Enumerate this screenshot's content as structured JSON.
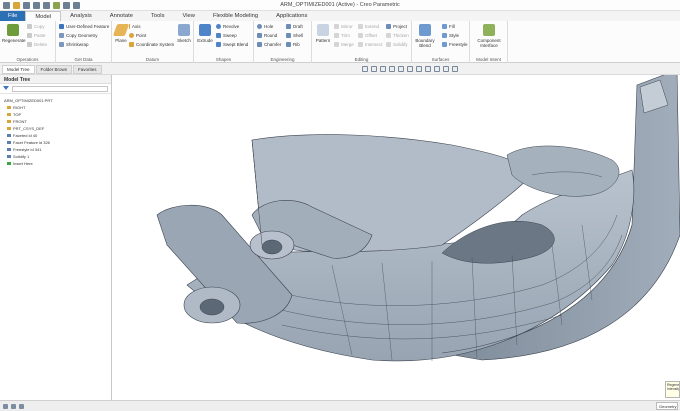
{
  "window": {
    "title": "ARM_OPTIMIZED001 (Active) - Creo Parametric"
  },
  "tabs": [
    {
      "label": "File"
    },
    {
      "label": "Model"
    },
    {
      "label": "Analysis"
    },
    {
      "label": "Annotate"
    },
    {
      "label": "Tools"
    },
    {
      "label": "View"
    },
    {
      "label": "Flexible Modeling"
    },
    {
      "label": "Applications"
    }
  ],
  "ribbon": {
    "operations": {
      "regenerate": "Regenerate",
      "copy": "Copy",
      "paste": "Paste",
      "delete": "Delete",
      "label": "Operations"
    },
    "get_data": {
      "udf": "User-Defined Feature",
      "copy_geometry": "Copy Geometry",
      "shrinkwrap": "Shrinkwrap",
      "label": "Get Data"
    },
    "datum": {
      "plane": "Plane",
      "axis": "Axis",
      "point": "Point",
      "csys": "Coordinate System",
      "sketch": "Sketch",
      "label": "Datum"
    },
    "shapes": {
      "extrude": "Extrude",
      "revolve": "Revolve",
      "sweep": "Sweep",
      "swept_blend": "Swept Blend",
      "label": "Shapes"
    },
    "engineering": {
      "hole": "Hole",
      "round": "Round",
      "chamfer": "Chamfer",
      "draft": "Draft",
      "shell": "Shell",
      "rib": "Rib",
      "label": "Engineering"
    },
    "editing": {
      "pattern": "Pattern",
      "mirror": "Mirror",
      "trim": "Trim",
      "merge": "Merge",
      "extend": "Extend",
      "offset": "Offset",
      "intersect": "Intersect",
      "project": "Project",
      "thicken": "Thicken",
      "solidify": "Solidify",
      "label": "Editing"
    },
    "surfaces": {
      "fill": "Fill",
      "style": "Style",
      "freestyle": "Freestyle",
      "boundary_blend": "Boundary Blend",
      "label": "Surfaces"
    },
    "model_intent": {
      "component_interface": "Component Interface",
      "label": "Model Intent"
    }
  },
  "panel_tabs": [
    {
      "label": "Model Tree"
    },
    {
      "label": "Folder Brows"
    },
    {
      "label": "Favorites"
    }
  ],
  "model_tree": {
    "title": "Model Tree",
    "items": [
      {
        "label": "ARM_OPTIMIZED001.PRT",
        "color": "#5c7fb0"
      },
      {
        "label": "RIGHT",
        "color": "#d9a43a"
      },
      {
        "label": "TOP",
        "color": "#d9a43a"
      },
      {
        "label": "FRONT",
        "color": "#d9a43a"
      },
      {
        "label": "PRT_CSYS_DEF",
        "color": "#d9a43a"
      },
      {
        "label": "Faceted id 40",
        "color": "#5c7fb0"
      },
      {
        "label": "Facet Feature id 326",
        "color": "#5c7fb0"
      },
      {
        "label": "Freestyle id 341",
        "color": "#5c7fb0"
      },
      {
        "label": "Solidify 1",
        "color": "#5c7fb0"
      },
      {
        "label": "Insert Here",
        "color": "#3aa645"
      }
    ]
  },
  "status": {
    "selection_filter": "Geometry",
    "tooltip": "Regenerate Intensity"
  },
  "colors": {
    "accent": "#2b6fb4",
    "part_fill": "#a7b2bf",
    "part_dark": "#7e8a98",
    "mesh_line": "#3c4450"
  }
}
